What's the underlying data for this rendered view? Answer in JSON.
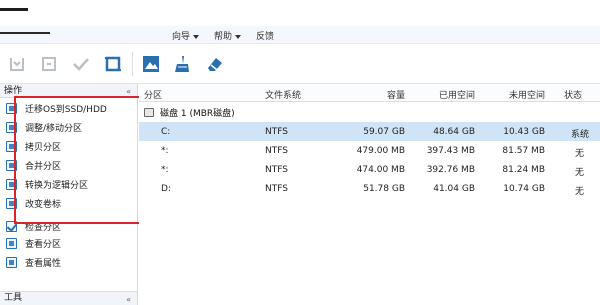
{
  "menubar": {
    "items": [
      {
        "label": "向导"
      },
      {
        "label": "帮助"
      },
      {
        "label": "反馈"
      }
    ]
  },
  "toolbar": {
    "buttons": [
      {
        "icon": "apply-icon"
      },
      {
        "icon": "undo-icon"
      },
      {
        "icon": "check-icon"
      },
      {
        "icon": "crop-icon"
      },
      {
        "icon": "partition-image-icon"
      },
      {
        "icon": "disk-cleanup-icon"
      },
      {
        "icon": "eraser-icon"
      }
    ]
  },
  "left_pane": {
    "header": "操作",
    "operations": [
      {
        "label": "迁移OS到SSD/HDD"
      },
      {
        "label": "调整/移动分区"
      },
      {
        "label": "拷贝分区"
      },
      {
        "label": "合并分区"
      },
      {
        "label": "转换为逻辑分区"
      },
      {
        "label": "改变卷标"
      },
      {
        "label": "检查分区"
      },
      {
        "label": "查看分区"
      },
      {
        "label": "查看属性"
      }
    ],
    "bottom_header": "工具"
  },
  "table": {
    "columns": [
      "分区",
      "文件系统",
      "容量",
      "已用空间",
      "未用空间",
      "状态"
    ],
    "disk_label": "磁盘 1 (MBR磁盘)",
    "rows": [
      {
        "partition": "C:",
        "fs": "NTFS",
        "capacity": "59.07 GB",
        "used": "48.64 GB",
        "free": "10.43 GB",
        "status": "系统",
        "selected": true
      },
      {
        "partition": "*:",
        "fs": "NTFS",
        "capacity": "479.00 MB",
        "used": "397.43 MB",
        "free": "81.57 MB",
        "status": "无",
        "selected": false
      },
      {
        "partition": "*:",
        "fs": "NTFS",
        "capacity": "474.00 MB",
        "used": "392.76 MB",
        "free": "81.24 MB",
        "status": "无",
        "selected": false
      },
      {
        "partition": "D:",
        "fs": "NTFS",
        "capacity": "51.78 GB",
        "used": "41.04 GB",
        "free": "10.74 GB",
        "status": "无",
        "selected": false
      }
    ]
  },
  "colors": {
    "highlight_box": "#d9252a",
    "selected_row": "#cfe4f7",
    "accent": "#2a6fb0"
  }
}
